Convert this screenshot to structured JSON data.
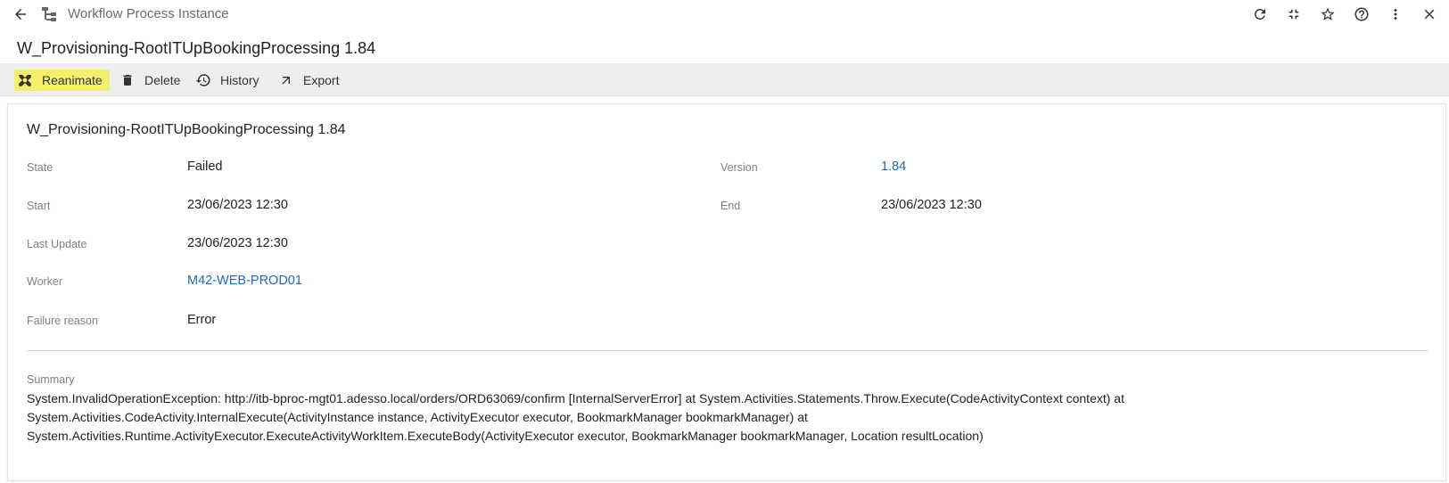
{
  "header": {
    "title": "Workflow Process Instance",
    "icons": [
      "back-arrow-icon",
      "workflow-icon",
      "refresh-icon",
      "collapse-icon",
      "star-icon",
      "help-icon",
      "more-vert-icon",
      "close-icon"
    ]
  },
  "page": {
    "title": "W_Provisioning-RootITUpBookingProcessing 1.84"
  },
  "toolbar": {
    "reanimate": "Reanimate",
    "delete": "Delete",
    "history": "History",
    "export": "Export",
    "highlight_color": "#f5f06b"
  },
  "card": {
    "title": "W_Provisioning-RootITUpBookingProcessing 1.84",
    "fields": {
      "state_label": "State",
      "state_value": "Failed",
      "version_label": "Version",
      "version_value": "1.84",
      "start_label": "Start",
      "start_value": "23/06/2023 12:30",
      "end_label": "End",
      "end_value": "23/06/2023 12:30",
      "last_update_label": "Last Update",
      "last_update_value": "23/06/2023 12:30",
      "worker_label": "Worker",
      "worker_value": "M42-WEB-PROD01",
      "failure_label": "Failure reason",
      "failure_value": "Error"
    },
    "summary_label": "Summary",
    "summary_lines": [
      "System.InvalidOperationException: http://itb-bproc-mgt01.adesso.local/orders/ORD63069/confirm [InternalServerError] at System.Activities.Statements.Throw.Execute(CodeActivityContext context) at",
      "System.Activities.CodeActivity.InternalExecute(ActivityInstance instance, ActivityExecutor executor, BookmarkManager bookmarkManager) at",
      "System.Activities.Runtime.ActivityExecutor.ExecuteActivityWorkItem.ExecuteBody(ActivityExecutor executor, BookmarkManager bookmarkManager, Location resultLocation)"
    ]
  },
  "colors": {
    "link": "#1a6ac2",
    "toolbar_bg": "#eeeeee"
  }
}
